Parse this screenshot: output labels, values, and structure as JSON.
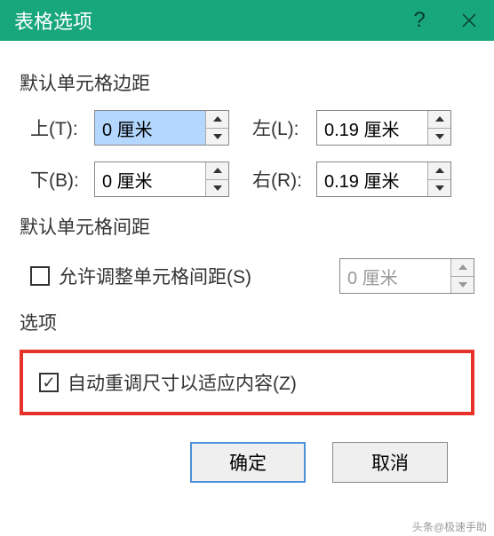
{
  "window": {
    "title": "表格选项"
  },
  "sections": {
    "margins_label": "默认单元格边距",
    "spacing_label": "默认单元格间距",
    "options_label": "选项"
  },
  "margins": {
    "top_label": "上(T):",
    "top_value": "0 厘米",
    "bottom_label": "下(B):",
    "bottom_value": "0 厘米",
    "left_label": "左(L):",
    "left_value": "0.19 厘米",
    "right_label": "右(R):",
    "right_value": "0.19 厘米"
  },
  "spacing": {
    "allow_label": "允许调整单元格间距(S)",
    "value": "0 厘米"
  },
  "options": {
    "autofit_label": "自动重调尺寸以适应内容(Z)"
  },
  "buttons": {
    "ok": "确定",
    "cancel": "取消"
  },
  "watermark": "头条@极速手助"
}
